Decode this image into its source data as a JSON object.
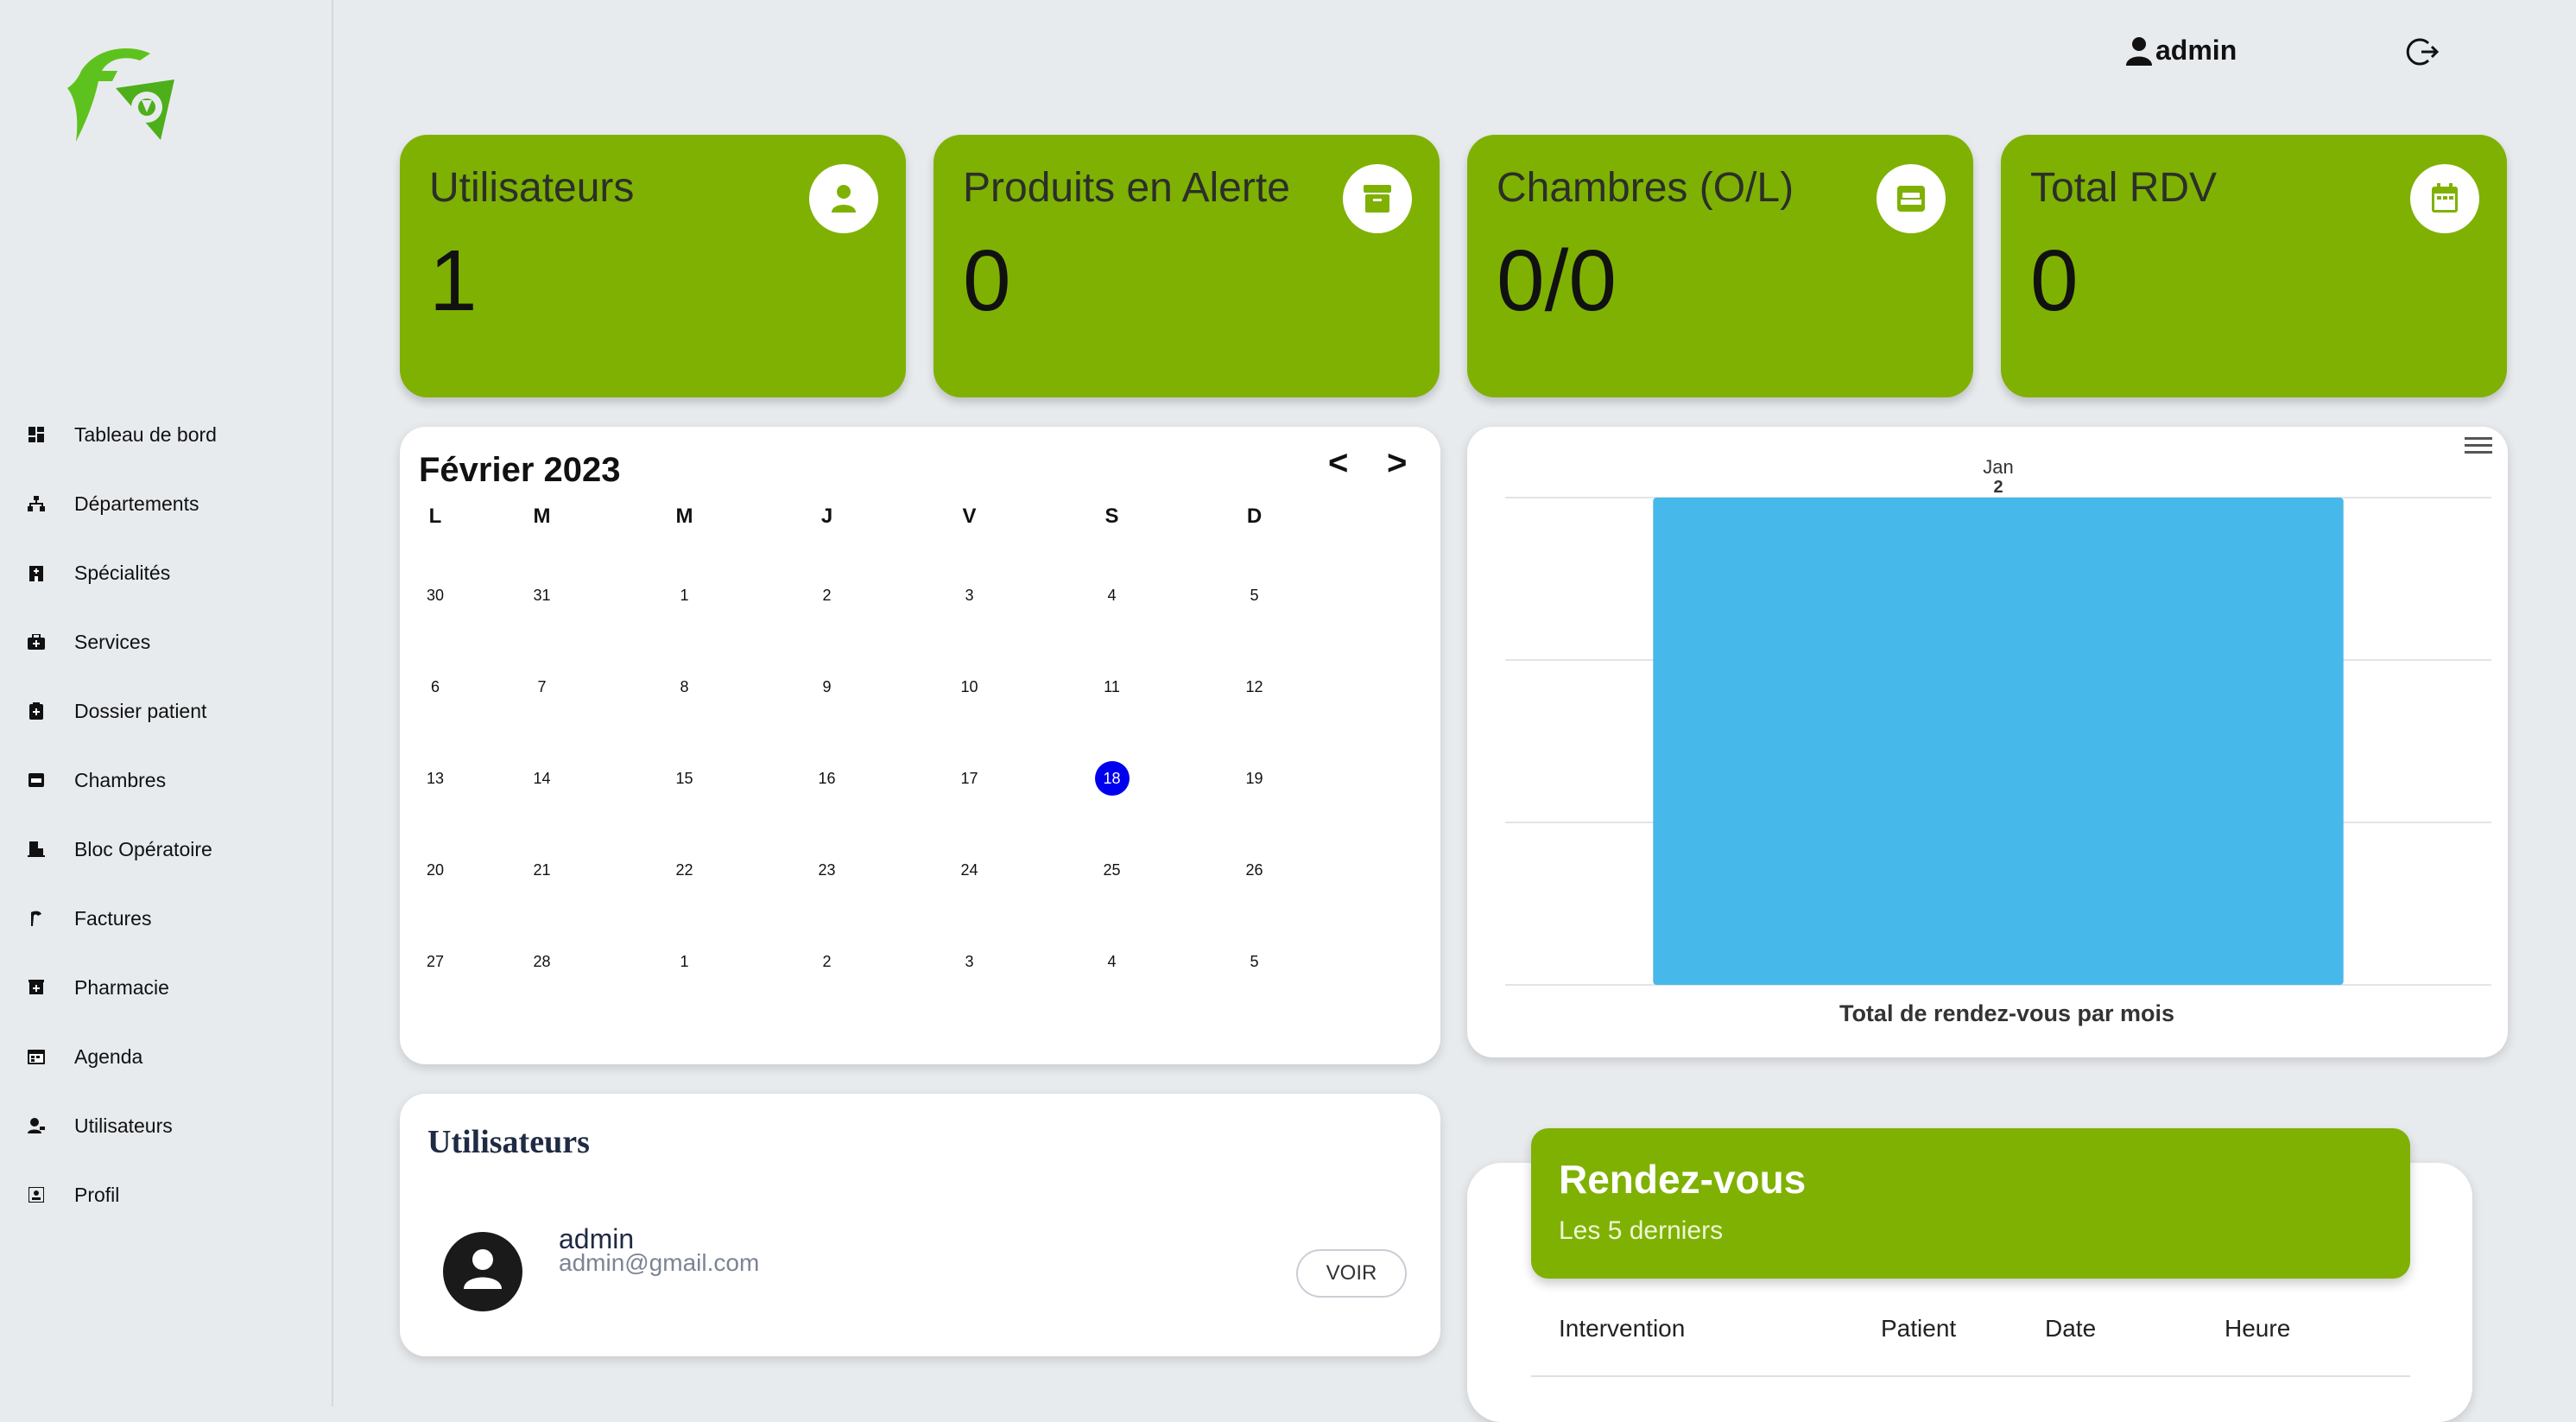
{
  "user": {
    "name": "admin"
  },
  "sidebar": {
    "items": [
      {
        "label": "Tableau de bord",
        "icon": "dashboard-icon"
      },
      {
        "label": "Départements",
        "icon": "sitemap-icon"
      },
      {
        "label": "Spécialités",
        "icon": "hospital-icon"
      },
      {
        "label": "Services",
        "icon": "medkit-icon"
      },
      {
        "label": "Dossier patient",
        "icon": "clipboard-icon"
      },
      {
        "label": "Chambres",
        "icon": "bed-icon"
      },
      {
        "label": "Bloc Opératoire",
        "icon": "door-icon"
      },
      {
        "label": "Factures",
        "icon": "billing-icon"
      },
      {
        "label": "Pharmacie",
        "icon": "pharmacy-icon"
      },
      {
        "label": "Agenda",
        "icon": "calendar-icon"
      },
      {
        "label": "Utilisateurs",
        "icon": "users-icon"
      },
      {
        "label": "Profil",
        "icon": "profile-icon"
      }
    ]
  },
  "stats": [
    {
      "title": "Utilisateurs",
      "value": "1",
      "icon": "user-icon"
    },
    {
      "title": "Produits en Alerte",
      "value": "0",
      "icon": "archive-icon"
    },
    {
      "title": "Chambres (O/L)",
      "value": "0/0",
      "icon": "bed-icon"
    },
    {
      "title": "Total RDV",
      "value": "0",
      "icon": "calendar-icon"
    }
  ],
  "calendar": {
    "title": "Février 2023",
    "prev": "<",
    "next": ">",
    "weekdays": [
      "L",
      "M",
      "M",
      "J",
      "V",
      "S",
      "D"
    ],
    "weeks": [
      [
        "30",
        "31",
        "1",
        "2",
        "3",
        "4",
        "5"
      ],
      [
        "6",
        "7",
        "8",
        "9",
        "10",
        "11",
        "12"
      ],
      [
        "13",
        "14",
        "15",
        "16",
        "17",
        "18",
        "19"
      ],
      [
        "20",
        "21",
        "22",
        "23",
        "24",
        "25",
        "26"
      ],
      [
        "27",
        "28",
        "1",
        "2",
        "3",
        "4",
        "5"
      ]
    ],
    "today": "18"
  },
  "chart_data": {
    "type": "bar",
    "categories": [
      "Jan"
    ],
    "values": [
      2
    ],
    "title": "",
    "xlabel": "Total de rendez-vous par mois",
    "ylabel": "",
    "ylim": [
      0,
      2
    ],
    "color": "#47b8ea",
    "grid": true
  },
  "users_panel": {
    "title": "Utilisateurs",
    "items": [
      {
        "name": "admin",
        "email": "admin@gmail.com",
        "action": "VOIR"
      }
    ]
  },
  "appointments": {
    "title": "Rendez-vous",
    "subtitle": "Les 5 derniers",
    "columns": [
      "Intervention",
      "Patient",
      "Date",
      "Heure"
    ]
  },
  "colors": {
    "accent": "#7fb102",
    "chart_bar": "#47b8ea",
    "today": "#0000ee"
  }
}
